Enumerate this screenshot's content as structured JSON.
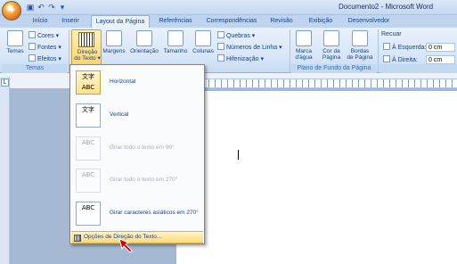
{
  "window": {
    "title": "Documento2 - Microsoft Word"
  },
  "tabs": [
    "Início",
    "Inserir",
    "Layout da Página",
    "Referências",
    "Correspondências",
    "Revisão",
    "Exibição",
    "Desenvolvedor"
  ],
  "ribbon": {
    "temas": {
      "btn": "Temas",
      "cores": "Cores",
      "fontes": "Fontes",
      "efeitos": "Efeitos",
      "group": "Temas"
    },
    "direcao": {
      "line1": "Direção",
      "line2": "do Texto"
    },
    "margens": "Margens",
    "orientacao": "Orientação",
    "tamanho": "Tamanho",
    "colunas": "Colunas",
    "quebras": "Quebras",
    "numeros_linha": "Números de Linha",
    "hifenizacao": "Hifenização",
    "marca": {
      "line1": "Marca",
      "line2": "d'água"
    },
    "cor": {
      "line1": "Cor da",
      "line2": "Página"
    },
    "bordas": {
      "line1": "Bordas",
      "line2": "de Página"
    },
    "plano_group": "Plano de Fundo da Página",
    "recuar": "Recuar",
    "esquerda": "À Esquerda:",
    "direita": "À Direita:",
    "esq_val": "0 cm",
    "dir_val": "0 cm"
  },
  "dropdown": {
    "options": [
      {
        "label": "Horizontal",
        "icon_text": "文字 ABC",
        "state": "selected"
      },
      {
        "label": "Vertical",
        "icon_text": "文字",
        "state": "normal"
      },
      {
        "label": "Girar todo o texto em 90°",
        "icon_text": "ABC",
        "state": "disabled"
      },
      {
        "label": "Girar todo o texto em 270°",
        "icon_text": "ABC",
        "state": "disabled"
      },
      {
        "label": "Girar caracteres asiáticos em 270°",
        "icon_text": "ABC",
        "state": "normal"
      }
    ],
    "footer": "Opções de Direção do Texto..."
  },
  "colors": {
    "accent": "#ffd56a",
    "ribbon": "#d6e5f7",
    "arrow": "#d40000"
  }
}
